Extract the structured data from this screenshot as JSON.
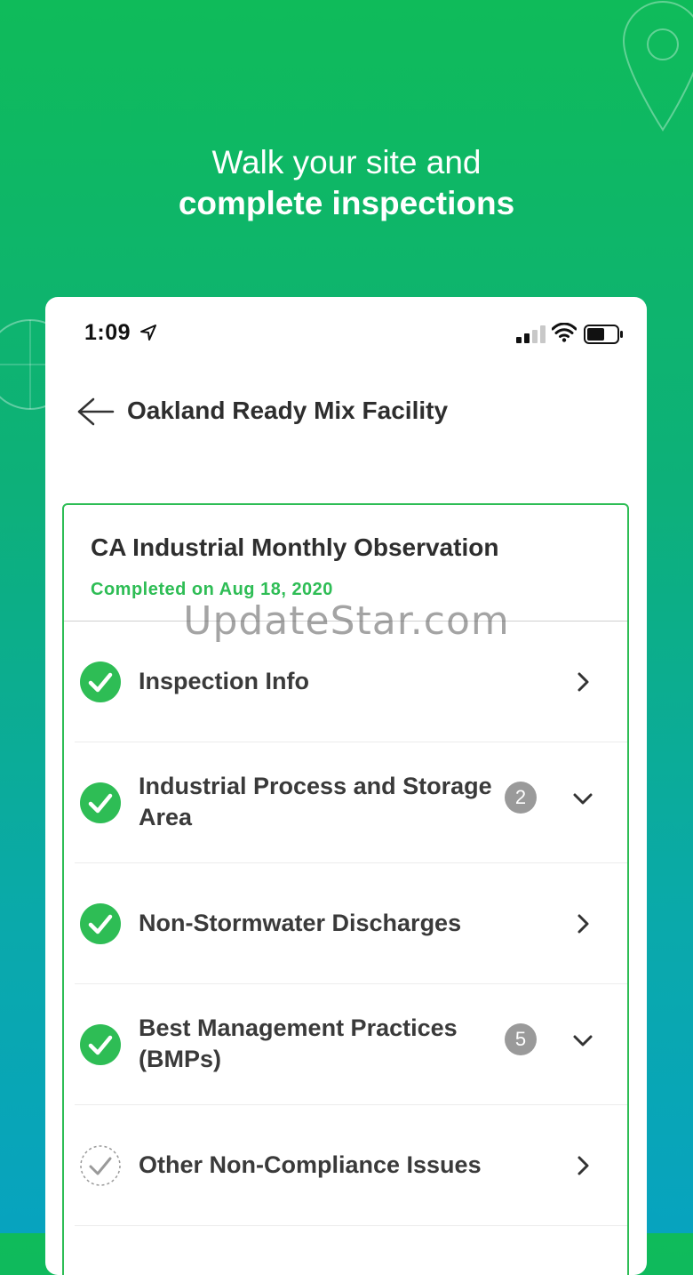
{
  "promo": {
    "line1": "Walk your site and",
    "line2": "complete inspections"
  },
  "status_bar": {
    "time": "1:09"
  },
  "header": {
    "title": "Oakland Ready Mix Facility"
  },
  "card": {
    "title": "CA Industrial Monthly Observation",
    "subtitle": "Completed on Aug 18, 2020"
  },
  "sections": [
    {
      "label": "Inspection Info",
      "completed": true,
      "expandable": false
    },
    {
      "label": "Industrial Process and Storage Area",
      "badge": "2",
      "completed": true,
      "expandable": true
    },
    {
      "label": "Non-Stormwater Discharges",
      "completed": true,
      "expandable": false
    },
    {
      "label": "Best Management Practices (BMPs)",
      "badge": "5",
      "completed": true,
      "expandable": true
    },
    {
      "label": "Other Non-Compliance Issues",
      "completed": false,
      "expandable": false
    }
  ],
  "watermark": "UpdateStar.com",
  "colors": {
    "brand_green": "#2ebd55",
    "gradient_top": "#0fbb5a",
    "gradient_bottom": "#07a3bf",
    "badge_gray": "#9a9a9a"
  }
}
